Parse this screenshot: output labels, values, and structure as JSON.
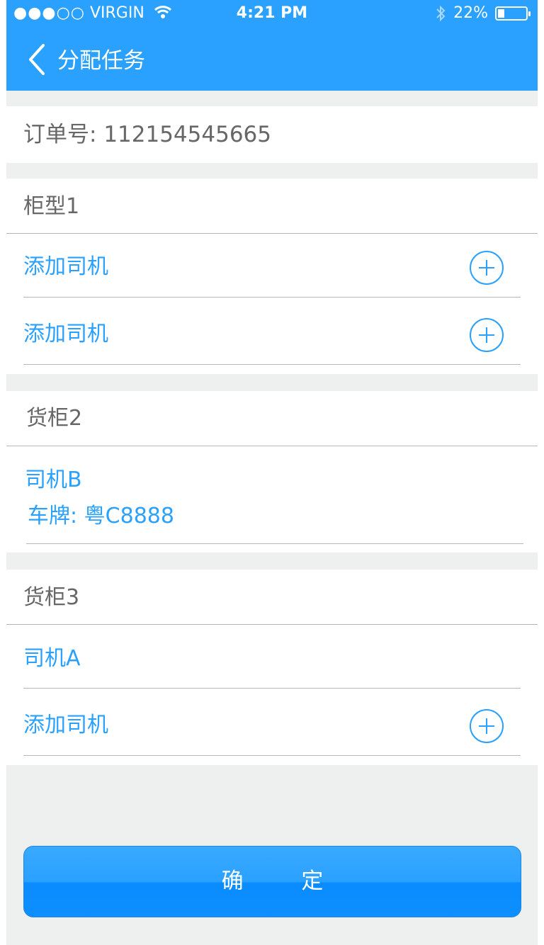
{
  "status_bar": {
    "carrier": "VIRGIN",
    "signal_dots": "●●●○○",
    "time": "4:21 PM",
    "battery": "22%"
  },
  "nav": {
    "title": "分配任务"
  },
  "order": {
    "label": "订单号:",
    "number": "112154545665"
  },
  "sections": [
    {
      "title": "柜型1",
      "rows": [
        {
          "label": "添加司机",
          "type": "add"
        },
        {
          "label": "添加司机",
          "type": "add"
        }
      ]
    },
    {
      "title": "货柜2",
      "rows": [
        {
          "label": "司机B",
          "type": "driver",
          "plate_label": "车牌:",
          "plate": "粤C8888"
        }
      ]
    },
    {
      "title": "货柜3",
      "rows": [
        {
          "label": "司机A",
          "type": "driver"
        },
        {
          "label": "添加司机",
          "type": "add"
        }
      ]
    }
  ],
  "confirm_label": "确 定",
  "colors": {
    "accent": "#2aa1ff",
    "background": "#eeefef",
    "text": "#676767",
    "divider": "#b7b7b7"
  },
  "icons": {
    "back": "chevron-left-icon",
    "add": "plus-circle-icon",
    "wifi": "wifi-icon",
    "bluetooth": "bluetooth-icon",
    "battery": "battery-icon"
  }
}
